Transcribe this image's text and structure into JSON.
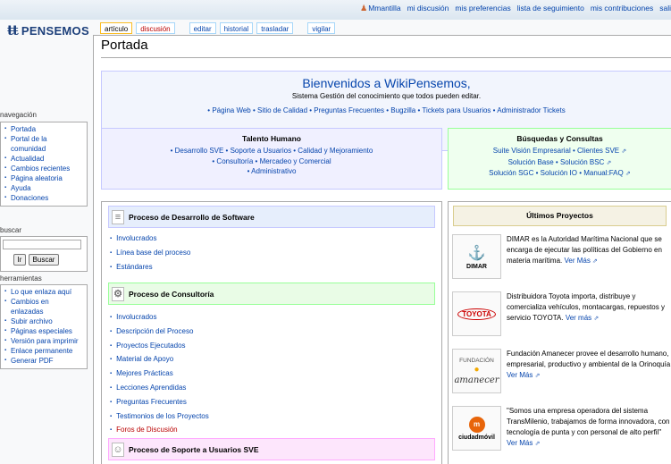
{
  "logo": {
    "text": "PENSEMOS",
    "mark": "ŧŧ"
  },
  "personal": [
    "Mmantilla",
    "mi discusión",
    "mis preferencias",
    "lista de seguimiento",
    "mis contribuciones",
    "sali"
  ],
  "tabs": [
    {
      "label": "artículo",
      "state": "selected"
    },
    {
      "label": "discusión",
      "state": "red"
    },
    {
      "label": "editar"
    },
    {
      "label": "historial"
    },
    {
      "label": "trasladar"
    },
    {
      "label": "vigilar"
    }
  ],
  "page_title": "Portada",
  "welcome": {
    "heading": "Bienvenidos a WikiPensemos,",
    "subheading": "Sistema Gestión del conocimiento que todos pueden editar.",
    "links": "• Página Web • Sitio de Calidad • Preguntas Frecuentes • Bugzilla • Tickets para Usuarios • Administrador Tickets"
  },
  "talento": {
    "title": "Talento Humano",
    "lines": [
      "• Desarrollo SVE • Soporte a Usuarios • Calidad y Mejoramiento",
      "• Consultoría • Mercadeo y Comercial",
      "• Administrativo"
    ]
  },
  "busquedas": {
    "title": "Búsquedas y Consultas",
    "lines": [
      "Suite Visión Empresarial • Clientes SVE",
      "Solución Base • Solución BSC",
      "Solución SGC • Solución IO • Manual:FAQ"
    ]
  },
  "sections": [
    {
      "title": "Proceso de Desarrollo de Software",
      "items": [
        "Involucrados",
        "Línea base del proceso",
        "Estándares"
      ]
    },
    {
      "title": "Proceso de Consultoría",
      "items": [
        "Involucrados",
        "Descripción del Proceso",
        "Proyectos Ejecutados",
        "Material de Apoyo",
        "Mejores Prácticas",
        "Lecciones Aprendidas",
        "Preguntas Frecuentes",
        "Testimonios de los Proyectos",
        "Foros de Discusión"
      ],
      "red_last": true
    },
    {
      "title": "Proceso de Soporte a Usuarios SVE",
      "items": []
    }
  ],
  "proyectos": {
    "title": "Últimos Proyectos",
    "items": [
      {
        "logo": "DIMAR",
        "text": "DIMAR es la Autoridad Marítima Nacional que se encarga de ejecutar las políticas del Gobierno en materia marítima.",
        "more": "Ver Más"
      },
      {
        "logo": "TOYOTA",
        "text": "Distribuidora Toyota importa, distribuye y comercializa vehículos, montacargas, repuestos y servicio TOYOTA.",
        "more": "Ver más"
      },
      {
        "logo_top": "FUNDACIÓN",
        "logo": "amanecer",
        "text": "Fundación Amanecer provee el desarrollo humano, empresarial, productivo y ambiental de la Orinoquía.",
        "more": "Ver Más"
      },
      {
        "logo": "ciudadmóvil",
        "text": "\"Somos una empresa operadora del sistema TransMilenio, trabajamos de forma innovadora, con tecnología de punta y con personal de alto perfil\"",
        "more": "Ver Más"
      }
    ]
  },
  "nav": {
    "heading": "navegación",
    "items": [
      "Portada",
      "Portal de la comunidad",
      "Actualidad",
      "Cambios recientes",
      "Página aleatoria",
      "Ayuda",
      "Donaciones"
    ]
  },
  "search": {
    "heading": "buscar",
    "go": "Ir",
    "search": "Buscar"
  },
  "tools": {
    "heading": "herramientas",
    "items": [
      "Lo que enlaza aquí",
      "Cambios en enlazadas",
      "Subir archivo",
      "Páginas especiales",
      "Versión para imprimir",
      "Enlace permanente",
      "Generar PDF"
    ]
  }
}
